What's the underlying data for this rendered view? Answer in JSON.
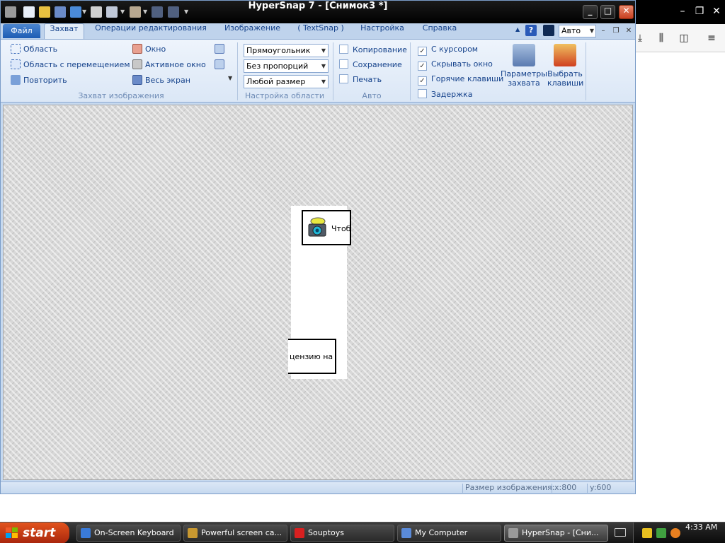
{
  "background_window": {
    "controls": {
      "minimize": "–",
      "restore": "❐",
      "close": "✕"
    },
    "toolbar_icons": [
      "download-icon",
      "library-icon",
      "sidebar-icon",
      "menu-icon"
    ]
  },
  "hypersnap": {
    "title": "HyperSnap 7 - [Снимок3 *]",
    "window_controls": {
      "minimize": "_",
      "maximize": "□",
      "close": "✕"
    },
    "tabs": [
      {
        "label": "Файл"
      },
      {
        "label": "Захват"
      },
      {
        "label": "Операции редактирования"
      },
      {
        "label": "Изображение"
      },
      {
        "label": "( TextSnap )"
      },
      {
        "label": "Настройка"
      },
      {
        "label": "Справка"
      }
    ],
    "help_label": "?",
    "auto_select_value": "Авто",
    "mdi_controls": {
      "minimize": "–",
      "restore": "❐",
      "close": "✕"
    },
    "ribbon": {
      "capture_group": {
        "label": "Захват изображения",
        "region": "Область",
        "region_scroll": "Область с перемещением",
        "repeat": "Повторить",
        "window": "Окно",
        "active_window": "Активное окно",
        "full_screen": "Весь экран"
      },
      "area_group": {
        "label": "Настройка области",
        "shape": "Прямоугольник",
        "proportion": "Без пропорций",
        "size": "Любой размер"
      },
      "auto_group": {
        "label": "Авто",
        "copy": "Копирование",
        "save": "Сохранение",
        "print": "Печать"
      },
      "options": {
        "with_cursor": "С курсором",
        "hide_window": "Скрывать окно",
        "hotkeys": "Горячие клавиши",
        "delay": "Задержка"
      },
      "capture_params": "Параметры\nзахвата",
      "choose_keys": "Выбрать\nклавиши"
    },
    "canvas": {
      "snapshot_text1": "Чтоб",
      "snapshot_text2": "цензию на"
    },
    "status": {
      "image_size": "Размер изображения:",
      "x": "x:800",
      "y": "y:600"
    }
  },
  "taskbar": {
    "start": "start",
    "tasks": [
      {
        "label": "On-Screen Keyboard"
      },
      {
        "label": "Powerful screen ca..."
      },
      {
        "label": "Souptoys"
      },
      {
        "label": "My Computer"
      },
      {
        "label": "HyperSnap - [Сни..."
      }
    ],
    "clock": "4:33 AM"
  }
}
